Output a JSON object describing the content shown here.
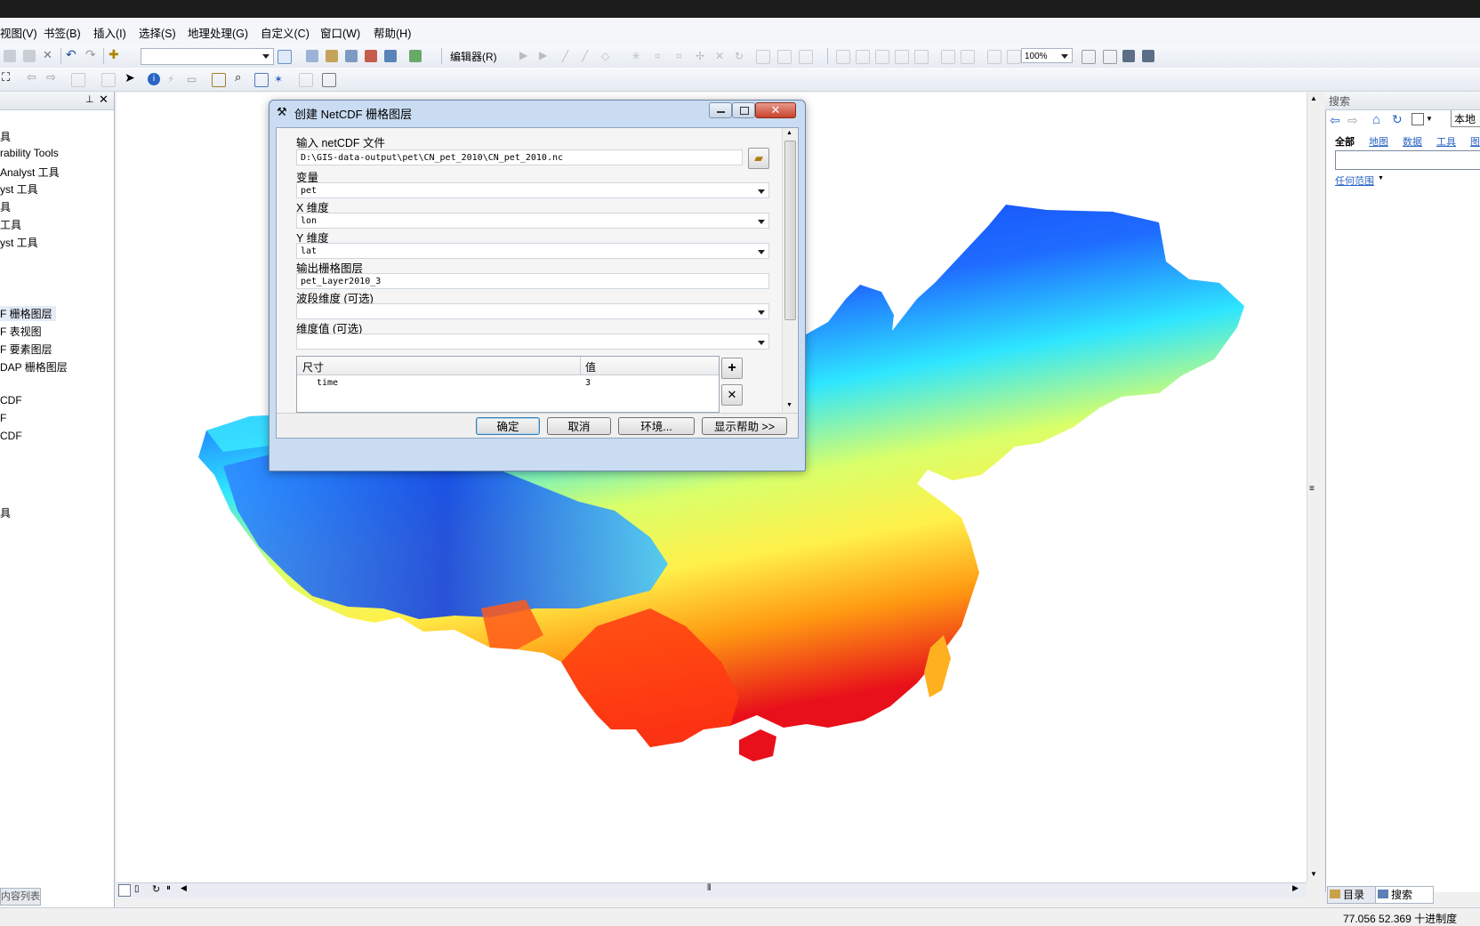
{
  "menubar": {
    "items": [
      "视图(V)",
      "书签(B)",
      "插入(I)",
      "选择(S)",
      "地理处理(G)",
      "自定义(C)",
      "窗口(W)",
      "帮助(H)"
    ]
  },
  "toolbar": {
    "editor_label": "编辑器(R)",
    "zoom_value": "100%"
  },
  "toc": {
    "items": [
      "具",
      "rability Tools",
      "Analyst 工具",
      "yst 工具",
      "具",
      "工具",
      "yst 工具",
      "F 栅格图层",
      "F 表视图",
      "F 要素图层",
      "DAP 栅格图层",
      "CDF",
      "F",
      "CDF",
      "具"
    ],
    "tab_label": "内容列表"
  },
  "search_panel": {
    "title": "搜索",
    "local_button": "本地",
    "filters": [
      "全部",
      "地图",
      "数据",
      "工具",
      "图"
    ],
    "scope_link": "任何范围",
    "tab_catalog": "目录",
    "tab_search": "搜索"
  },
  "dialog": {
    "title": "创建 NetCDF 栅格图层",
    "input_label": "输入 netCDF 文件",
    "input_value": "D:\\GIS-data-output\\pet\\CN_pet_2010\\CN_pet_2010.nc",
    "variable_label": "变量",
    "variable_value": "pet",
    "x_label": "X 维度",
    "x_value": "lon",
    "y_label": "Y 维度",
    "y_value": "lat",
    "output_label": "输出栅格图层",
    "output_value": "pet_Layer2010_3",
    "band_label": "波段维度 (可选)",
    "band_value": "",
    "dimval_label": "维度值 (可选)",
    "dimval_value": "",
    "table_header_dim": "尺寸",
    "table_header_val": "值",
    "table_rows": [
      {
        "dim": "time",
        "val": "3"
      }
    ],
    "buttons": {
      "ok": "确定",
      "cancel": "取消",
      "env": "环境...",
      "help": "显示帮助 >>"
    }
  },
  "status": {
    "coords": "77.056  52.369 十进制度"
  },
  "colors": {
    "map_blue": "#0a2df0",
    "map_cyan": "#2ee6ff",
    "map_yellow": "#fff04a",
    "map_red": "#e8101a",
    "cursor_highlight": "#ffe400"
  }
}
